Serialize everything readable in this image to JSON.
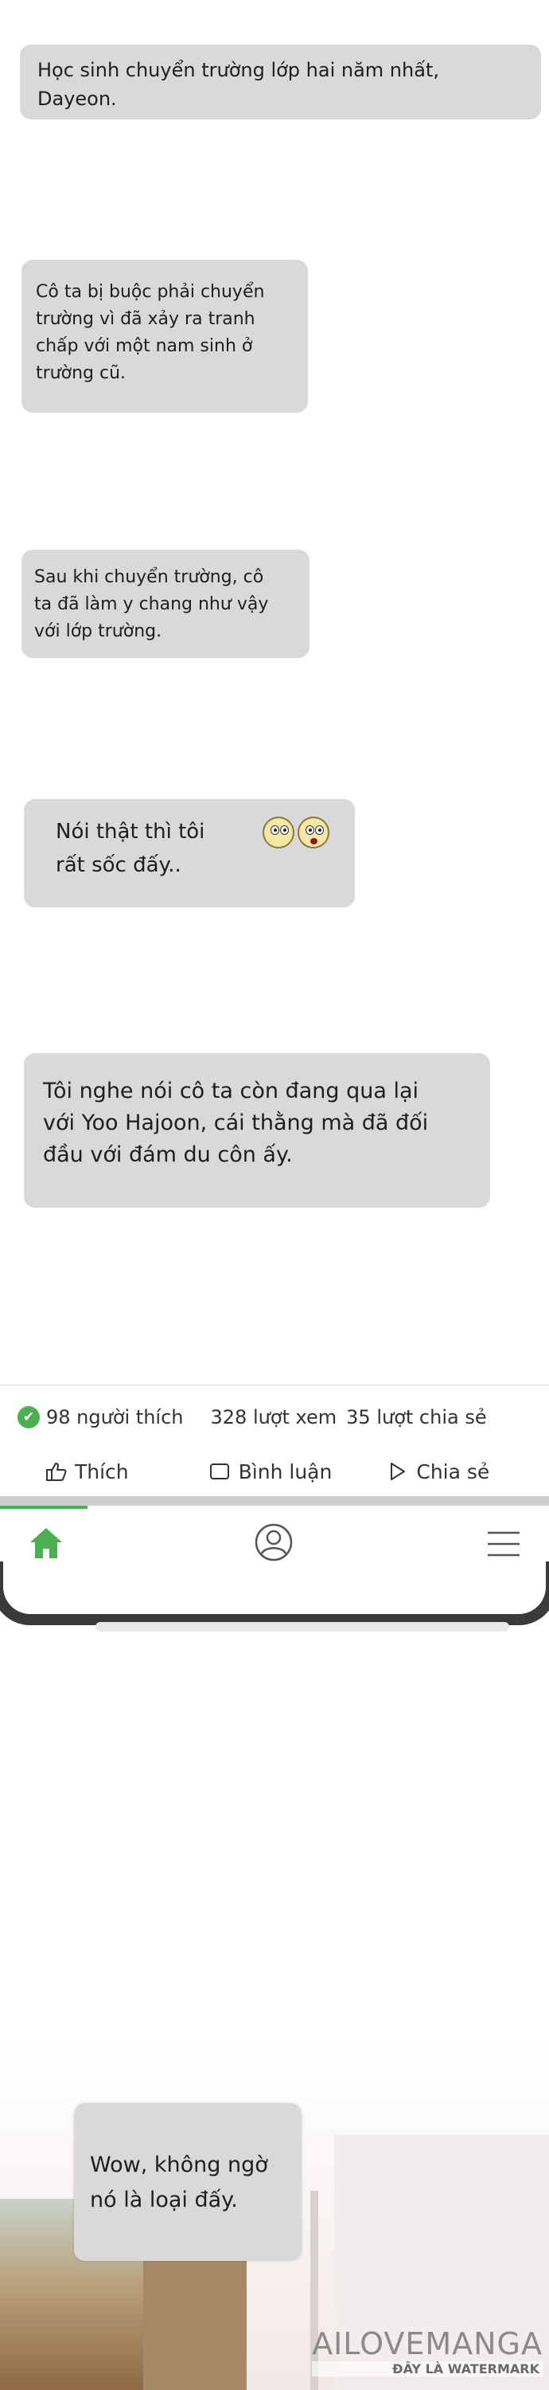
{
  "messages": [
    {
      "text": "Học sinh chuyển trường lớp hai năm nhất,\nDayeon."
    },
    {
      "text": "Cô ta bị buộc phải chuyển\ntrường vì đã xảy ra tranh\nchấp với một nam sinh ở\ntrường cũ."
    },
    {
      "text": "Sau khi chuyển trường, cô\nta đã làm y chang như vậy\nvới lớp trường."
    },
    {
      "text": "Nói thật thì tôi\nrất sốc đấy.."
    },
    {
      "text": "Tôi nghe nói cô ta còn đang qua lại\nvới Yoo Hajoon, cái thằng mà đã đối\nđầu với đám du côn ấy."
    },
    {
      "text": "Wow, không ngờ\nnó là loại đấy."
    }
  ],
  "post_stats": {
    "likes": "98 người thích",
    "views": "328 lượt xem",
    "shares": "35 lượt chia sẻ"
  },
  "post_actions": {
    "like": "Thích",
    "comment": "Bình luận",
    "share": "Chia sẻ"
  },
  "nav": {
    "items": [
      "home-icon",
      "profile-icon",
      "menu-icon"
    ],
    "active_color": "#4caf50"
  },
  "watermark": {
    "brand": "AILOVEMANGA",
    "note": "ĐÂY LÀ WATERMARK"
  },
  "colors": {
    "bubble": "#d9d9d9",
    "accent": "#4caf50"
  }
}
